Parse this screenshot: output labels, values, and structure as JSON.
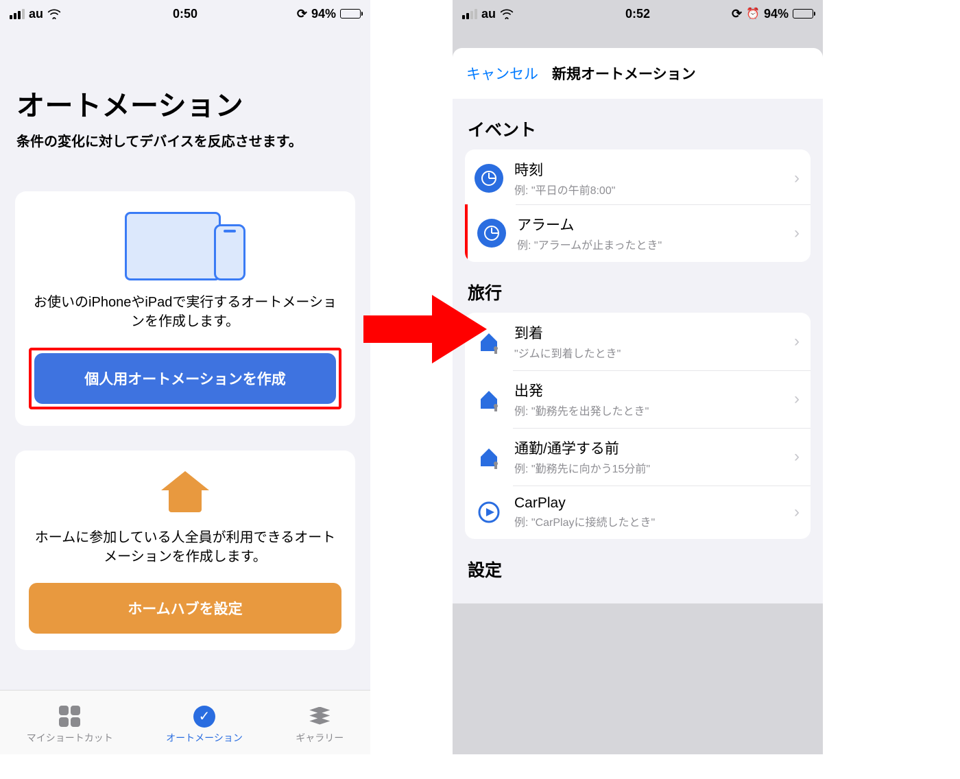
{
  "left": {
    "status": {
      "carrier": "au",
      "time": "0:50",
      "battery_pct": "94%"
    },
    "title": "オートメーション",
    "subtitle": "条件の変化に対してデバイスを反応させます。",
    "card1": {
      "desc": "お使いのiPhoneやiPadで実行するオートメーションを作成します。",
      "button": "個人用オートメーションを作成"
    },
    "card2": {
      "desc": "ホームに参加している人全員が利用できるオートメーションを作成します。",
      "button": "ホームハブを設定"
    },
    "tabs": {
      "shortcuts": "マイショートカット",
      "automation": "オートメーション",
      "gallery": "ギャラリー"
    }
  },
  "right": {
    "status": {
      "carrier": "au",
      "time": "0:52",
      "battery_pct": "94%"
    },
    "cancel": "キャンセル",
    "modal_title": "新規オートメーション",
    "section_event": "イベント",
    "events": [
      {
        "title": "時刻",
        "sub": "例: \"平日の午前8:00\""
      },
      {
        "title": "アラーム",
        "sub": "例: \"アラームが止まったとき\""
      }
    ],
    "section_travel": "旅行",
    "travel": [
      {
        "title": "到着",
        "sub": "\"ジムに到着したとき\""
      },
      {
        "title": "出発",
        "sub": "例: \"勤務先を出発したとき\""
      },
      {
        "title": "通勤/通学する前",
        "sub": "例: \"勤務先に向かう15分前\""
      },
      {
        "title": "CarPlay",
        "sub": "例: \"CarPlayに接続したとき\""
      }
    ],
    "section_settings": "設定"
  }
}
